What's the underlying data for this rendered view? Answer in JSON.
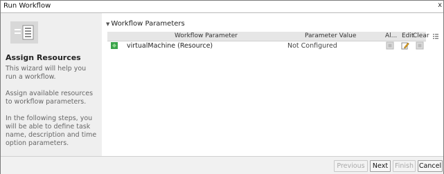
{
  "window": {
    "title": "Run Workflow",
    "close_label": "x"
  },
  "left": {
    "heading": "Assign Resources",
    "paragraphs": [
      "This wizard will help you run a workflow.",
      "Assign available resources to workflow parameters.",
      "In the following steps, you will be able to define task name, description and time option parameters."
    ]
  },
  "section": {
    "title": "Workflow Parameters"
  },
  "table": {
    "headers": [
      "Workflow Parameter",
      "Parameter Value",
      "Al...",
      "Edit",
      "Clear"
    ],
    "rows": [
      {
        "parameter": "virtualMachine (Resource)",
        "value": "Not Configured"
      }
    ]
  },
  "footer": {
    "buttons": [
      "Previous",
      "Next",
      "Finish",
      "Cancel"
    ]
  },
  "colors": {
    "header_bg": "#e6e6e6",
    "left_bg": "#efefef",
    "footer_bg": "#f1f1f1",
    "icon_green": "#3aa34a"
  }
}
